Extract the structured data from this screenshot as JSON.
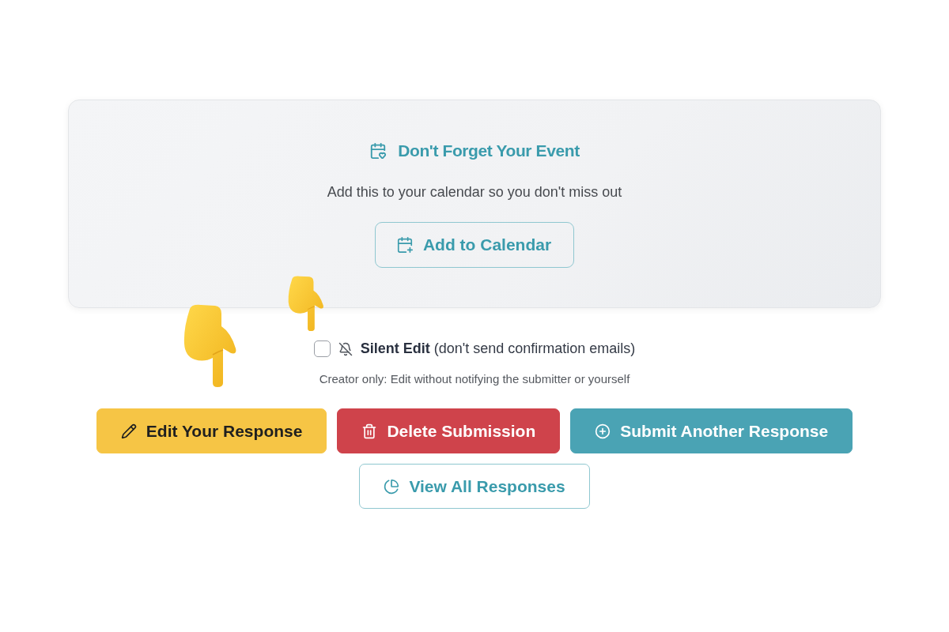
{
  "reminder_card": {
    "title": "Don't Forget Your Event",
    "subtitle": "Add this to your calendar so you don't miss out",
    "button": "Add to Calendar"
  },
  "silent_edit": {
    "checked": false,
    "label": "**Silent Edit** (don't send confirmation emails)",
    "hint": "Creator only: Edit without notifying the submitter or yourself"
  },
  "actions": [
    {
      "kind": "edit",
      "label": "Edit Your Response"
    },
    {
      "kind": "delete",
      "label": "Delete Submission"
    },
    {
      "kind": "submit",
      "label": "Submit Another Response"
    },
    {
      "kind": "view",
      "label": "View All Responses"
    }
  ]
}
